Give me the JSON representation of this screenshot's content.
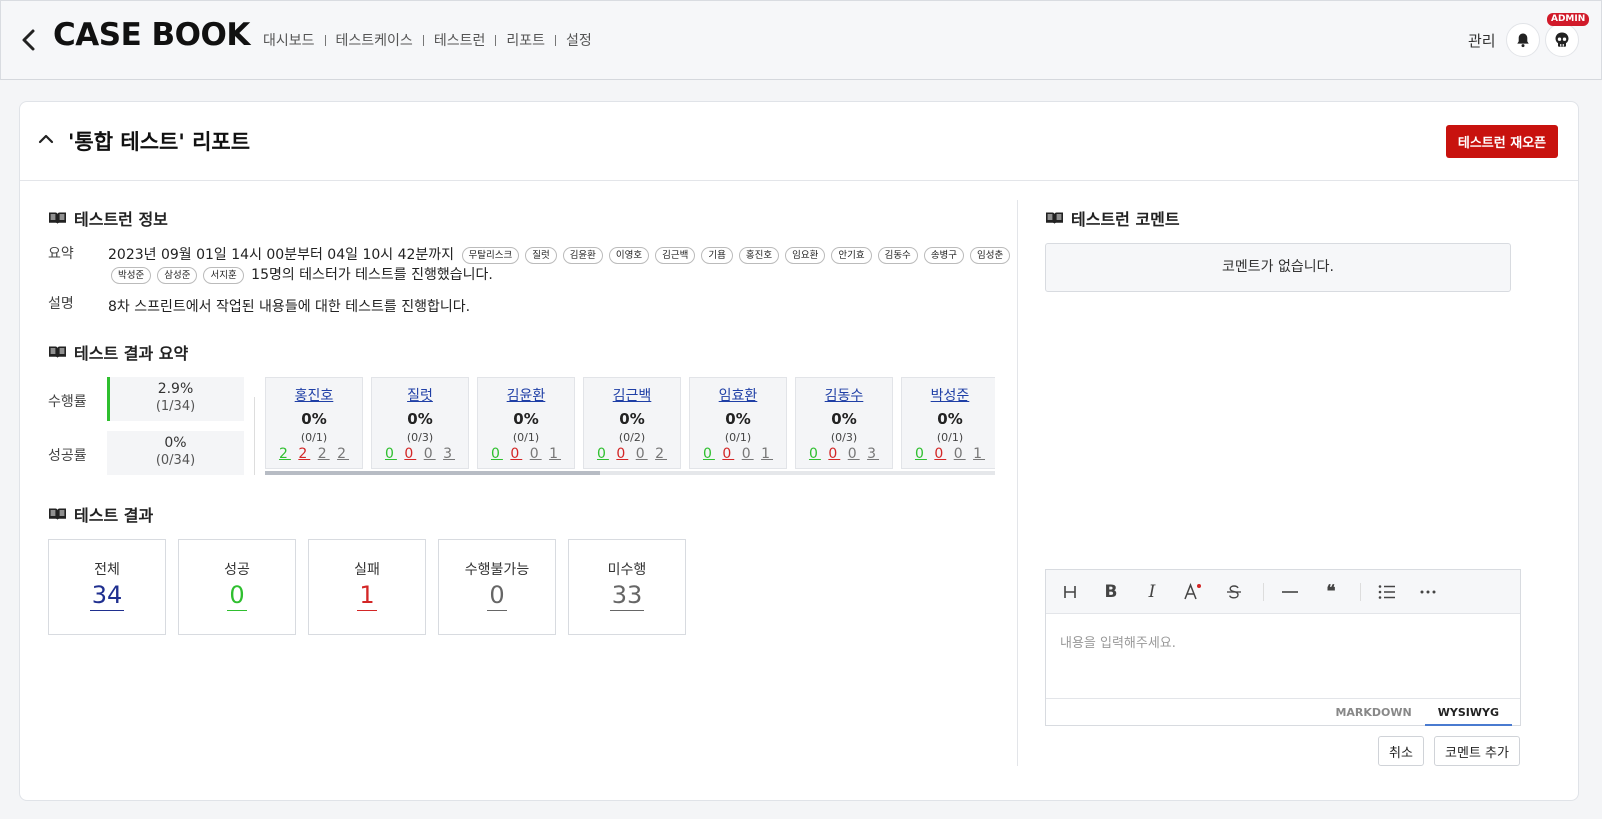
{
  "header": {
    "logo": "CASE BOOK",
    "nav": [
      "대시보드",
      "테스트케이스",
      "테스트런",
      "리포트",
      "설정"
    ],
    "manage": "관리",
    "admin_badge": "ADMIN"
  },
  "panel": {
    "title": "'통합 테스트' 리포트",
    "reopen_button": "테스트런 재오픈"
  },
  "info": {
    "heading": "테스트런 정보",
    "summary_label": "요약",
    "summary_period": "2023년 09월 01일 14시 00분부터 04일 10시 42분까지",
    "testers": [
      "무탈리스크",
      "질럿",
      "김윤환",
      "이영호",
      "김근백",
      "기욤",
      "홍진호",
      "임요환",
      "안기효",
      "김동수",
      "송병구",
      "임성춘",
      "박성준",
      "삼성준",
      "서지훈"
    ],
    "summary_tail": "15명의 테스터가 테스트를 진행했습니다.",
    "desc_label": "설명",
    "desc": "8차 스프린트에서 작업된 내용들에 대한 테스트를 진행합니다."
  },
  "result_summary": {
    "heading": "테스트 결과 요약",
    "progress_label": "수행률",
    "progress_pct": "2.9%",
    "progress_frac": "(1/34)",
    "progress_value": 0.029,
    "success_label": "성공률",
    "success_pct": "0%",
    "success_frac": "(0/34)",
    "testers": [
      {
        "name": "홍진호",
        "pct": "0%",
        "frac": "(0/1)",
        "counts": [
          "2",
          "2",
          "2",
          "2"
        ]
      },
      {
        "name": "질럿",
        "pct": "0%",
        "frac": "(0/3)",
        "counts": [
          "0",
          "0",
          "0",
          "3"
        ]
      },
      {
        "name": "김윤환",
        "pct": "0%",
        "frac": "(0/1)",
        "counts": [
          "0",
          "0",
          "0",
          "1"
        ]
      },
      {
        "name": "김근백",
        "pct": "0%",
        "frac": "(0/2)",
        "counts": [
          "0",
          "0",
          "0",
          "2"
        ]
      },
      {
        "name": "임효환",
        "pct": "0%",
        "frac": "(0/1)",
        "counts": [
          "0",
          "0",
          "0",
          "1"
        ]
      },
      {
        "name": "김동수",
        "pct": "0%",
        "frac": "(0/3)",
        "counts": [
          "0",
          "0",
          "0",
          "3"
        ]
      },
      {
        "name": "박성준",
        "pct": "0%",
        "frac": "(0/1)",
        "counts": [
          "0",
          "0",
          "0",
          "1"
        ]
      }
    ]
  },
  "results": {
    "heading": "테스트 결과",
    "boxes": [
      {
        "label": "전체",
        "value": "34",
        "color": "#1f2f8f"
      },
      {
        "label": "성공",
        "value": "0",
        "color": "#2fbf2f"
      },
      {
        "label": "실패",
        "value": "1",
        "color": "#d32626"
      },
      {
        "label": "수행불가능",
        "value": "0",
        "color": "#666666"
      },
      {
        "label": "미수행",
        "value": "33",
        "color": "#666666"
      }
    ]
  },
  "comments": {
    "heading": "테스트런 코멘트",
    "empty": "코멘트가 없습니다.",
    "placeholder": "내용을 입력해주세요.",
    "toolbar": [
      "heading-icon",
      "bold-icon",
      "italic-icon",
      "text-color-icon",
      "strikethrough-icon",
      "horizontal-rule-icon",
      "quote-icon",
      "bullet-list-icon",
      "more-icon"
    ],
    "mode_markdown": "MARKDOWN",
    "mode_wysiwyg": "WYSIWYG",
    "cancel": "취소",
    "add": "코멘트 추가"
  }
}
